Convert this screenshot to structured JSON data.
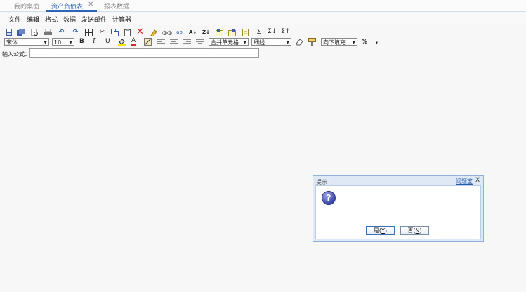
{
  "tabs": [
    {
      "label": "我的桌面"
    },
    {
      "label": "资产负债表",
      "close": "✕"
    },
    {
      "label": "报表数据"
    }
  ],
  "menu": [
    "文件",
    "编辑",
    "格式",
    "数据",
    "发送邮件",
    "计算器"
  ],
  "toolbar": {
    "font_family": "宋体",
    "font_size": "10",
    "bold": "B",
    "italic": "I",
    "underline": "U",
    "font_color": "A",
    "merge": "合并单元格",
    "border": "细线",
    "fill": "向下填充",
    "percent": "%",
    "comma": ","
  },
  "formula": {
    "label": "输入公式："
  },
  "dialog": {
    "title": "提示",
    "help": "问题宝",
    "close": "X",
    "yes_prefix": "是(",
    "yes_key": "Y",
    "yes_suffix": ")",
    "no_prefix": "否(",
    "no_key": "N",
    "no_suffix": ")"
  },
  "colors": {
    "accent": "#2b65b7",
    "dialog_border": "#8fb0d8"
  }
}
